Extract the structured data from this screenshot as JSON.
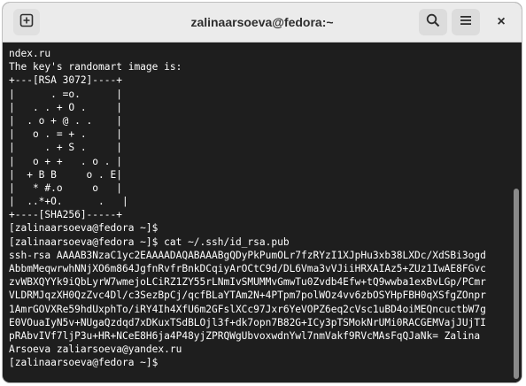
{
  "window": {
    "title": "zalinaarsoeva@fedora:~"
  },
  "icons": {
    "new_tab": "new-tab-icon",
    "search": "search-icon",
    "menu": "hamburger-menu-icon",
    "close": "close-icon"
  },
  "close_glyph": "×",
  "terminal": {
    "lines": [
      "ndex.ru",
      "The key's randomart image is:",
      "+---[RSA 3072]----+",
      "|      . =o.      |",
      "|   . . + O .     |",
      "|  . o + @ . .    |",
      "|   o . = + .     |",
      "|     . + S .     |",
      "|   o + +   . o . |",
      "|  + B B     o . E|",
      "|   * #.o     o   |",
      "|  ..*+O.      .   |",
      "+----[SHA256]-----+",
      "[zalinaarsoeva@fedora ~]$",
      "[zalinaarsoeva@fedora ~]$ cat ~/.ssh/id_rsa.pub",
      "ssh-rsa AAAAB3NzaC1yc2EAAAADAQABAAABgQDyPkPumOLr7fzRYzI1XJpHu3xb38LXDc/XdSBi3ogd",
      "AbbmMeqwrwhNNjXO6m864JgfnRvfrBnkDCqiyArOCtC9d/DL6Vma3vVJiiHRXAIAz5+ZUz1IwAE8FGvc",
      "zvWBXQYYk9iQbLyrW7wmejoLCiRZ1ZY55rLNmIvSMUMMvGmwTu0Zvdb4Efw+tQ9wwba1exBvLGp/PCmr",
      "VLDRMJqzXH0QzZvc4Dl/c3SezBpCj/qcfBLaYTAm2N+4PTpm7polWOz4vv6zbOSYHpFBH0qXSfgZOnpr",
      "1AmrGOVXRe59hdUxphTo/iRY4Ih4XfU6m2GFslXCc97Jxr6YeVOPZ6eq2cVsc1uBD4oiMEQncuctbW7g",
      "E0VOuaIyN5v+NUgaQzdqd7xDKuxTSdBLOjl3f+dk7opn7B82G+ICy3pTSMokNrUMi0RACGEMVajJUjTI",
      "pRAbvIVf7ljP3u+HR+NCeE8H6ja4P48yjZPRQWgUbvoxwdnYwl7nmVakf9RVcMAsFqQJaNk= Zalina",
      "Arsoeva zaliarsoeva@yandex.ru",
      "[zalinaarsoeva@fedora ~]$ "
    ]
  }
}
